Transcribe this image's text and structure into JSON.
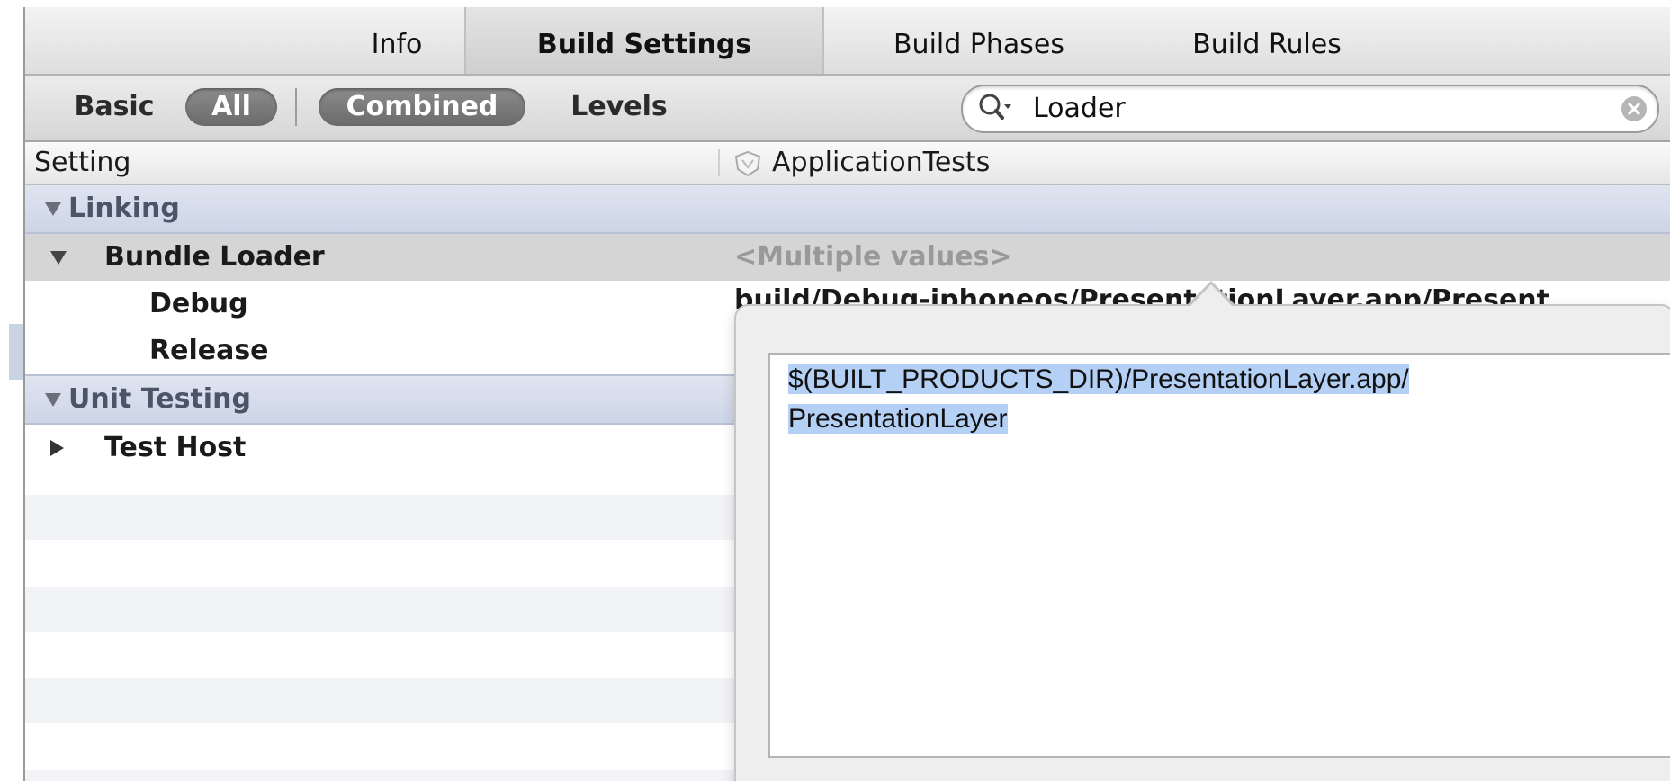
{
  "tabs": [
    {
      "label": "Info"
    },
    {
      "label": "Build Settings",
      "selected": true
    },
    {
      "label": "Build Phases"
    },
    {
      "label": "Build Rules"
    }
  ],
  "filter": {
    "basic": "Basic",
    "all": "All",
    "combined": "Combined",
    "levels": "Levels",
    "search_value": "Loader"
  },
  "columns": {
    "setting": "Setting",
    "target": "ApplicationTests"
  },
  "groups": {
    "linking": "Linking",
    "unit_testing": "Unit Testing"
  },
  "rows": {
    "bundle_loader": {
      "label": "Bundle Loader",
      "value": "<Multiple values>",
      "debug_label": "Debug",
      "debug_value": "build/Debug-iphoneos/PresentationLayer.app/Present",
      "release_label": "Release"
    },
    "test_host": {
      "label": "Test Host"
    }
  },
  "popover": {
    "line1": "$(BUILT_PRODUCTS_DIR)/PresentationLayer.app/",
    "line2": "PresentationLayer"
  },
  "colors": {
    "group_bg": "#cdd5e6",
    "selection": "#b4d0f5",
    "segment_selected": "#7a7a7a"
  }
}
